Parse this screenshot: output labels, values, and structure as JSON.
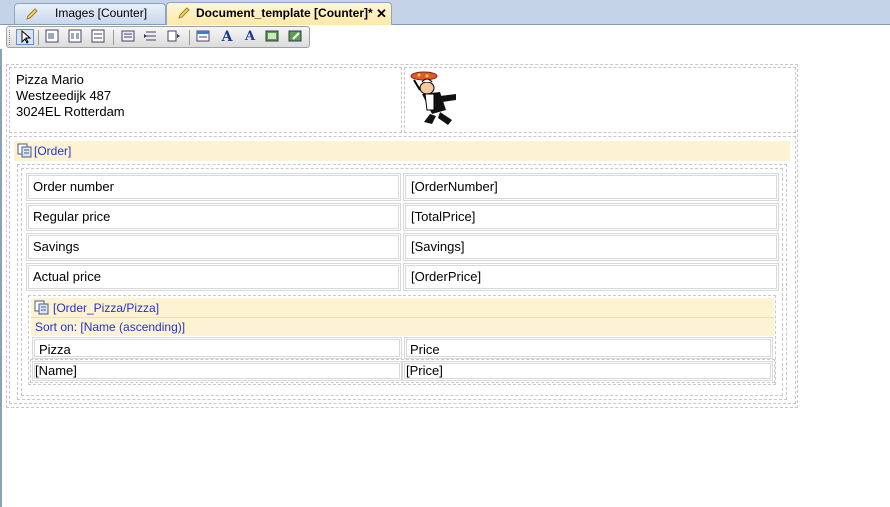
{
  "tabs": [
    {
      "label": "Images [Counter]"
    },
    {
      "label": "Document_template [Counter]*",
      "close": "✕"
    }
  ],
  "toolbar": {
    "icons": [
      "pointer-icon",
      "table-icon",
      "table-split-icon",
      "table-merge-icon",
      "list-icon",
      "insert-row-icon",
      "insert-column-icon",
      "properties-icon",
      "font-icon",
      "font-color-icon",
      "image-icon",
      "image-edit-icon"
    ]
  },
  "address": {
    "line1": "Pizza  Mario",
    "line2": "Westzeedijk 487",
    "line3": "3024EL Rotterdam"
  },
  "order_section": {
    "header": "[Order]",
    "rows": [
      {
        "label": "Order number",
        "value": "[OrderNumber]"
      },
      {
        "label": "Regular price",
        "value": "[TotalPrice]"
      },
      {
        "label": "Savings",
        "value": "[Savings]"
      },
      {
        "label": "Actual price",
        "value": "[OrderPrice]"
      }
    ]
  },
  "pizza_section": {
    "header": "[Order_Pizza/Pizza]",
    "sort": "Sort on: [Name (ascending)]",
    "columns": [
      "Pizza",
      "Price"
    ],
    "row": [
      "[Name]",
      "[Price]"
    ]
  },
  "colors": {
    "accent_header": "#fdf3d2",
    "link": "#2233cc",
    "tab_active": "#ffe9a8"
  }
}
